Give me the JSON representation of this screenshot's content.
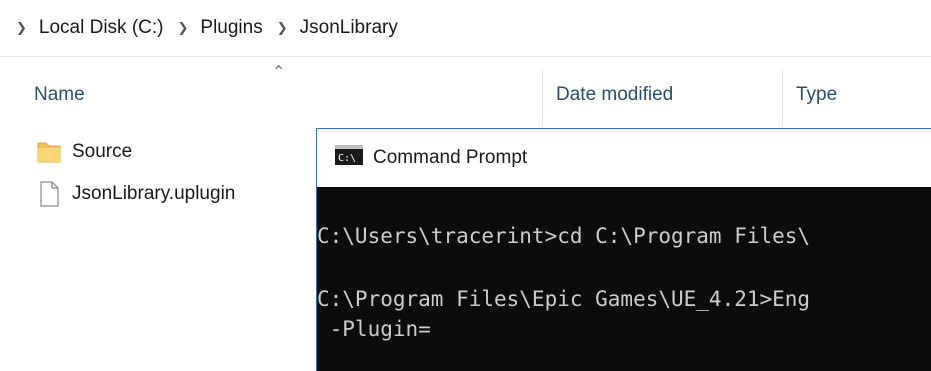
{
  "breadcrumb": {
    "items": [
      "Local Disk (C:)",
      "Plugins",
      "JsonLibrary"
    ]
  },
  "columns": {
    "name": "Name",
    "date_modified": "Date modified",
    "type": "Type"
  },
  "files": [
    {
      "name": "Source",
      "icon": "folder-icon"
    },
    {
      "name": "JsonLibrary.uplugin",
      "icon": "file-icon"
    }
  ],
  "cmd": {
    "title": "Command Prompt",
    "lines": [
      "C:\\Users\\tracerint>cd C:\\Program Files\\",
      "C:\\Program Files\\Epic Games\\UE_4.21>Eng",
      " -Plugin="
    ]
  },
  "colors": {
    "header_text": "#2b4b6f",
    "folder": "#f0c050",
    "console_bg": "#0c0c0c",
    "console_text": "#cccccc",
    "window_border": "#3c6ec2"
  }
}
